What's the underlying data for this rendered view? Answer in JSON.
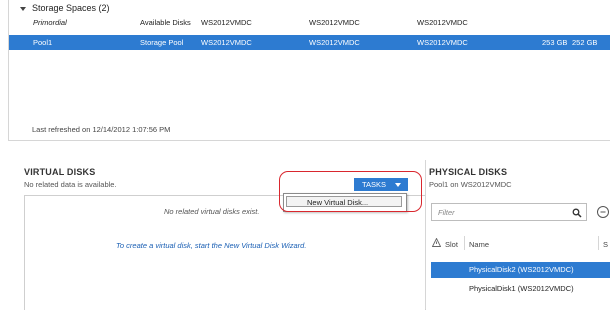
{
  "storage_spaces": {
    "group_label": "Storage Spaces (2)",
    "rows": [
      {
        "name": "Primordial",
        "type": "Available Disks",
        "managed_by": "WS2012VMDC",
        "available_to": "WS2012VMDC",
        "read_write_server": "WS2012VMDC",
        "capacity": "",
        "free_space": ""
      },
      {
        "name": "Pool1",
        "type": "Storage Pool",
        "managed_by": "WS2012VMDC",
        "available_to": "WS2012VMDC",
        "read_write_server": "WS2012VMDC",
        "capacity": "253 GB",
        "free_space": "252 GB"
      }
    ],
    "last_refreshed": "Last refreshed on 12/14/2012 1:07:56 PM"
  },
  "virtual_disks": {
    "title": "VIRTUAL DISKS",
    "subtitle": "No related data is available.",
    "tasks_label": "TASKS",
    "menu_items": [
      "New Virtual Disk..."
    ],
    "empty_message": "No related virtual disks exist.",
    "wizard_hint": "To create a virtual disk, start the New Virtual Disk Wizard."
  },
  "physical_disks": {
    "title": "PHYSICAL DISKS",
    "subtitle": "Pool1 on WS2012VMDC",
    "filter_placeholder": "Filter",
    "columns": {
      "slot": "Slot",
      "name": "Name",
      "partial": "S"
    },
    "rows": [
      {
        "name": "PhysicalDisk2 (WS2012VMDC)",
        "selected": true
      },
      {
        "name": "PhysicalDisk1 (WS2012VMDC)",
        "selected": false
      }
    ]
  },
  "colors": {
    "accent": "#2d7bd1",
    "highlight": "#d9272e"
  },
  "icons": [
    "chevron-down-icon",
    "search-icon",
    "view-options-icon",
    "warning-icon"
  ]
}
